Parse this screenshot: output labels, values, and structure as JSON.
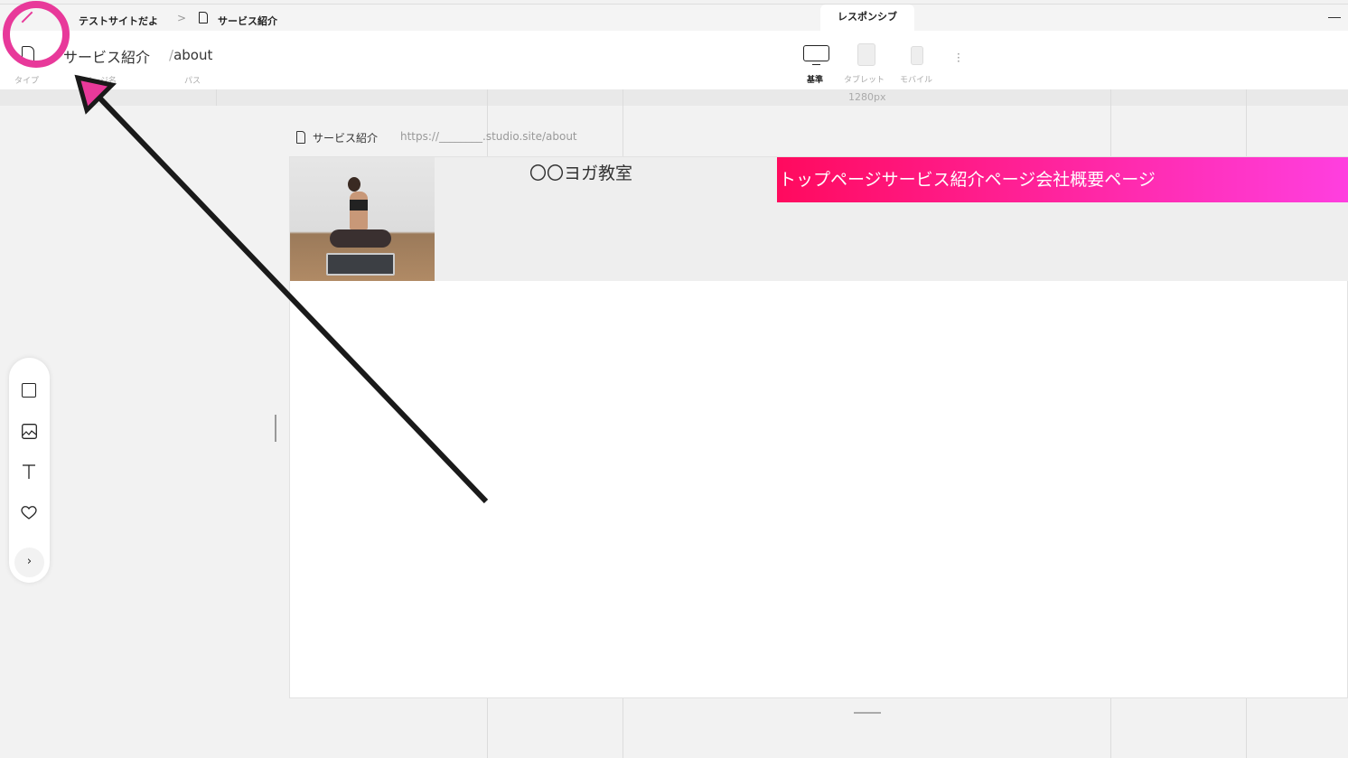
{
  "breadcrumb": {
    "site": "テストサイトだよ",
    "separator": ">",
    "page": "サービス紹介"
  },
  "tabs": [
    {
      "label": "レスポンシブ",
      "active": true
    }
  ],
  "page_info": {
    "name": "サービス紹介",
    "path_prefix": "/",
    "path": "about",
    "labels": {
      "type": "タイプ",
      "name": "ページ名",
      "path": "パス"
    }
  },
  "devices": [
    {
      "label": "基準",
      "active": true
    },
    {
      "label": "タブレット"
    },
    {
      "label": "モバイル"
    }
  ],
  "ruler": {
    "width_label": "1280px"
  },
  "canvas": {
    "page_label": "サービス紹介",
    "url": "https://________.studio.site/about"
  },
  "site": {
    "title": "〇〇ヨガ教室",
    "nav": "トップページサービス紹介ページ会社概要ページ"
  },
  "tools": [
    "box-icon",
    "image-icon",
    "text-icon",
    "heart-icon",
    "chevron-right-icon"
  ],
  "colors": {
    "nav_start": "#ff0a5e",
    "nav_end": "#ff3fe0",
    "annotation": "#e8399a"
  }
}
